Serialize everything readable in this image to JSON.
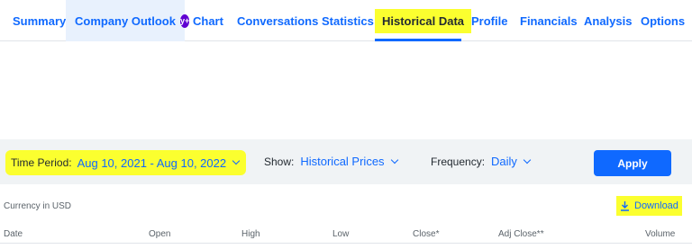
{
  "tabs": [
    {
      "label": "Summary"
    },
    {
      "label": "Company Outlook",
      "badge": "y+"
    },
    {
      "label": "Chart"
    },
    {
      "label": "Conversations"
    },
    {
      "label": "Statistics"
    },
    {
      "label": "Historical Data",
      "active": true
    },
    {
      "label": "Profile"
    },
    {
      "label": "Financials"
    },
    {
      "label": "Analysis"
    },
    {
      "label": "Options"
    }
  ],
  "controls": {
    "time_period_label": "Time Period:",
    "time_period_value": "Aug 10, 2021 - Aug 10, 2022",
    "show_label": "Show:",
    "show_value": "Historical Prices",
    "frequency_label": "Frequency:",
    "frequency_value": "Daily",
    "apply_label": "Apply"
  },
  "currency_note": "Currency in USD",
  "download_label": "Download",
  "table": {
    "columns": [
      "Date",
      "Open",
      "High",
      "Low",
      "Close*",
      "Adj Close**",
      "Volume"
    ]
  },
  "colors": {
    "accent": "#0f69ff",
    "highlight": "#fbff2f",
    "badge": "#6001d2"
  },
  "icons": {
    "download": "download-arrow-icon",
    "dropdown": "chevron-down-icon"
  }
}
